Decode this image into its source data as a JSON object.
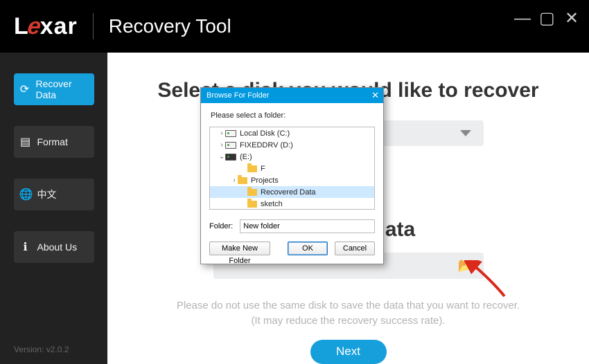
{
  "app": {
    "brand": "Lexar",
    "tool": "Recovery Tool",
    "version": "Version: v2.0.2"
  },
  "sidebar": {
    "items": [
      {
        "label": "Recover Data"
      },
      {
        "label": "Format"
      },
      {
        "label": "中文"
      },
      {
        "label": "About Us"
      }
    ]
  },
  "main": {
    "headline": "Select a disk you would like to recover",
    "save_headline": "ave your data",
    "note_line1": "Please do not use the same disk to save the data that you want to recover.",
    "note_line2": "(It may reduce the recovery success rate).",
    "next_label": "Next"
  },
  "dialog": {
    "title": "Browse For Folder",
    "prompt": "Please select a folder:",
    "tree": {
      "items": [
        {
          "label": "Local Disk (C:)",
          "icon": "drive",
          "indent": 1,
          "twisty": ">"
        },
        {
          "label": "FIXEDDRV (D:)",
          "icon": "drive",
          "indent": 1,
          "twisty": ">"
        },
        {
          "label": "(E:)",
          "icon": "drive-dark",
          "indent": 1,
          "twisty": "v"
        },
        {
          "label": "F",
          "icon": "folder",
          "indent": 3,
          "twisty": ""
        },
        {
          "label": "Projects",
          "icon": "folder",
          "indent": 2,
          "twisty": ">"
        },
        {
          "label": "Recovered Data",
          "icon": "folder",
          "indent": 3,
          "twisty": "",
          "selected": true
        },
        {
          "label": "sketch",
          "icon": "folder",
          "indent": 3,
          "twisty": ""
        }
      ]
    },
    "folder_label": "Folder:",
    "folder_value": "New folder",
    "make_new": "Make New Folder",
    "ok": "OK",
    "cancel": "Cancel"
  }
}
